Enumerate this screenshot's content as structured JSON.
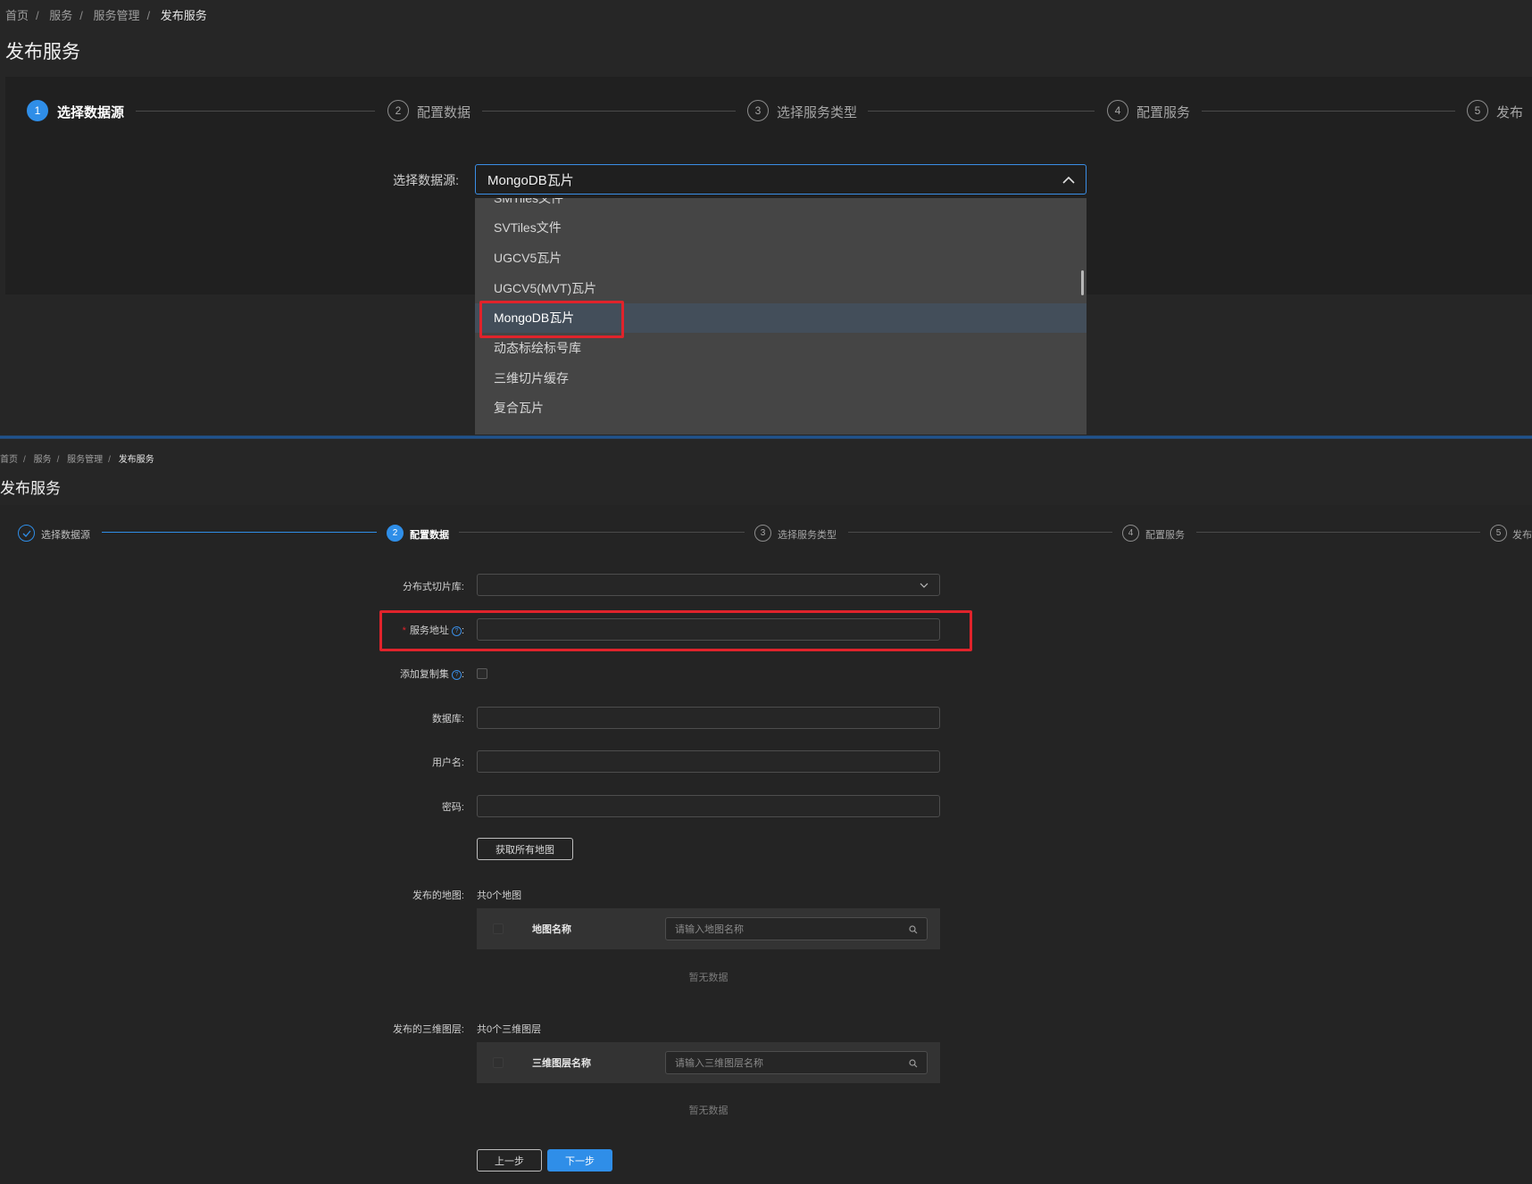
{
  "top": {
    "breadcrumb": [
      "首页",
      "服务",
      "服务管理",
      "发布服务"
    ],
    "title": "发布服务",
    "steps": [
      {
        "num": "1",
        "label": "选择数据源"
      },
      {
        "num": "2",
        "label": "配置数据"
      },
      {
        "num": "3",
        "label": "选择服务类型"
      },
      {
        "num": "4",
        "label": "配置服务"
      },
      {
        "num": "5",
        "label": "发布"
      }
    ],
    "source_label": "选择数据源:",
    "source_value": "MongoDB瓦片",
    "dropdown_items": [
      "SMTiles文件",
      "SVTiles文件",
      "UGCV5瓦片",
      "UGCV5(MVT)瓦片",
      "MongoDB瓦片",
      "动态标绘标号库",
      "三维切片缓存",
      "复合瓦片",
      "..."
    ]
  },
  "bottom": {
    "breadcrumb": [
      "首页",
      "服务",
      "服务管理",
      "发布服务"
    ],
    "title": "发布服务",
    "steps": [
      {
        "num": "✓",
        "label": "选择数据源"
      },
      {
        "num": "2",
        "label": "配置数据"
      },
      {
        "num": "3",
        "label": "选择服务类型"
      },
      {
        "num": "4",
        "label": "配置服务"
      },
      {
        "num": "5",
        "label": "发布"
      }
    ],
    "form": {
      "tile_lib_label": "分布式切片库:",
      "service_addr_label": "服务地址",
      "replica_label": "添加复制集",
      "database_label": "数据库:",
      "username_label": "用户名:",
      "password_label": "密码:",
      "fetch_maps_button": "获取所有地图",
      "maps_label": "发布的地图:",
      "maps_count": "共0个地图",
      "map_name_col": "地图名称",
      "map_search_placeholder": "请输入地图名称",
      "maps_empty": "暂无数据",
      "layers_label": "发布的三维图层:",
      "layers_count": "共0个三维图层",
      "layer_name_col": "三维图层名称",
      "layer_search_placeholder": "请输入三维图层名称",
      "layers_empty": "暂无数据",
      "prev_button": "上一步",
      "next_button": "下一步"
    }
  },
  "colors": {
    "accent": "#2f8ee8",
    "highlight_box": "#e0232b",
    "background": "#262626"
  }
}
